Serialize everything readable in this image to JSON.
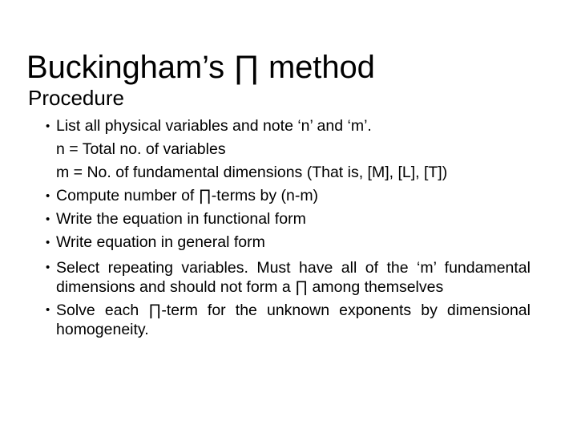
{
  "slide": {
    "title": "Buckingham’s ∏ method",
    "subtitle": "Procedure",
    "bullet_glyph": "•",
    "items": [
      {
        "kind": "bullet",
        "text": "List all physical variables and note ‘n’ and ‘m’."
      },
      {
        "kind": "sub",
        "text": "n = Total no. of variables"
      },
      {
        "kind": "sub",
        "text": "m = No. of fundamental dimensions (That is, [M], [L], [T])"
      },
      {
        "kind": "bullet",
        "text": "Compute number of  ∏-terms by (n-m)"
      },
      {
        "kind": "bullet",
        "text": "Write the equation in functional form"
      },
      {
        "kind": "bullet",
        "text": "Write equation in general form"
      },
      {
        "kind": "paragraph",
        "text": "Select repeating variables. Must have all of the ‘m’ fundamental dimensions and should not form a ∏ among themselves"
      },
      {
        "kind": "paragraph",
        "text": "Solve each ∏-term for the unknown exponents by dimensional homogeneity."
      }
    ]
  }
}
